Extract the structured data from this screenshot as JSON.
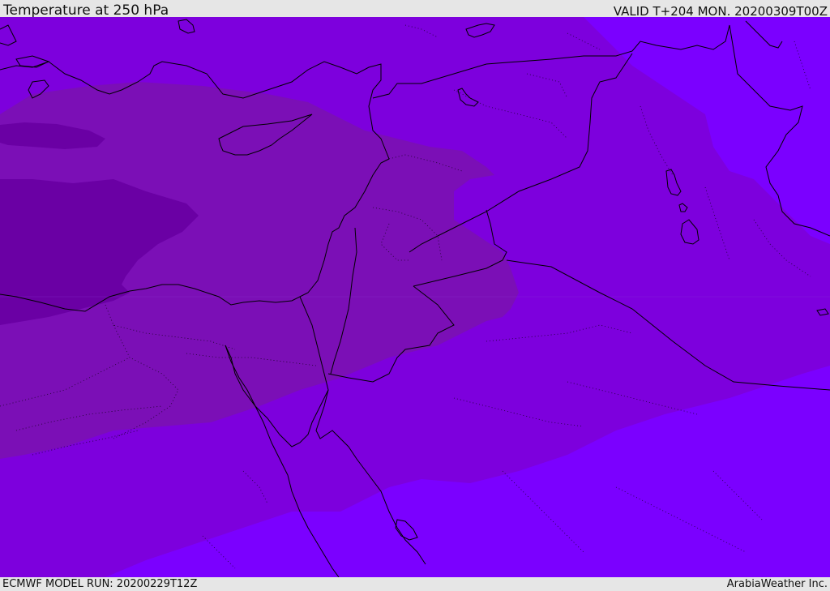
{
  "header": {
    "title": "Temperature at 250 hPa",
    "valid": "VALID T+204 MON. 20200309T00Z"
  },
  "footer": {
    "model_run": "ECMWF MODEL RUN: 20200229T12Z",
    "credit": "ArabiaWeather Inc."
  },
  "map": {
    "region": "Eastern Mediterranean / Levant",
    "colors": {
      "deep_violet": "#6a00a4",
      "dark_violet": "#7b0fb6",
      "mid_violet": "#7d00dd",
      "bright_violet": "#7b00ff",
      "coastline": "#000000"
    }
  }
}
